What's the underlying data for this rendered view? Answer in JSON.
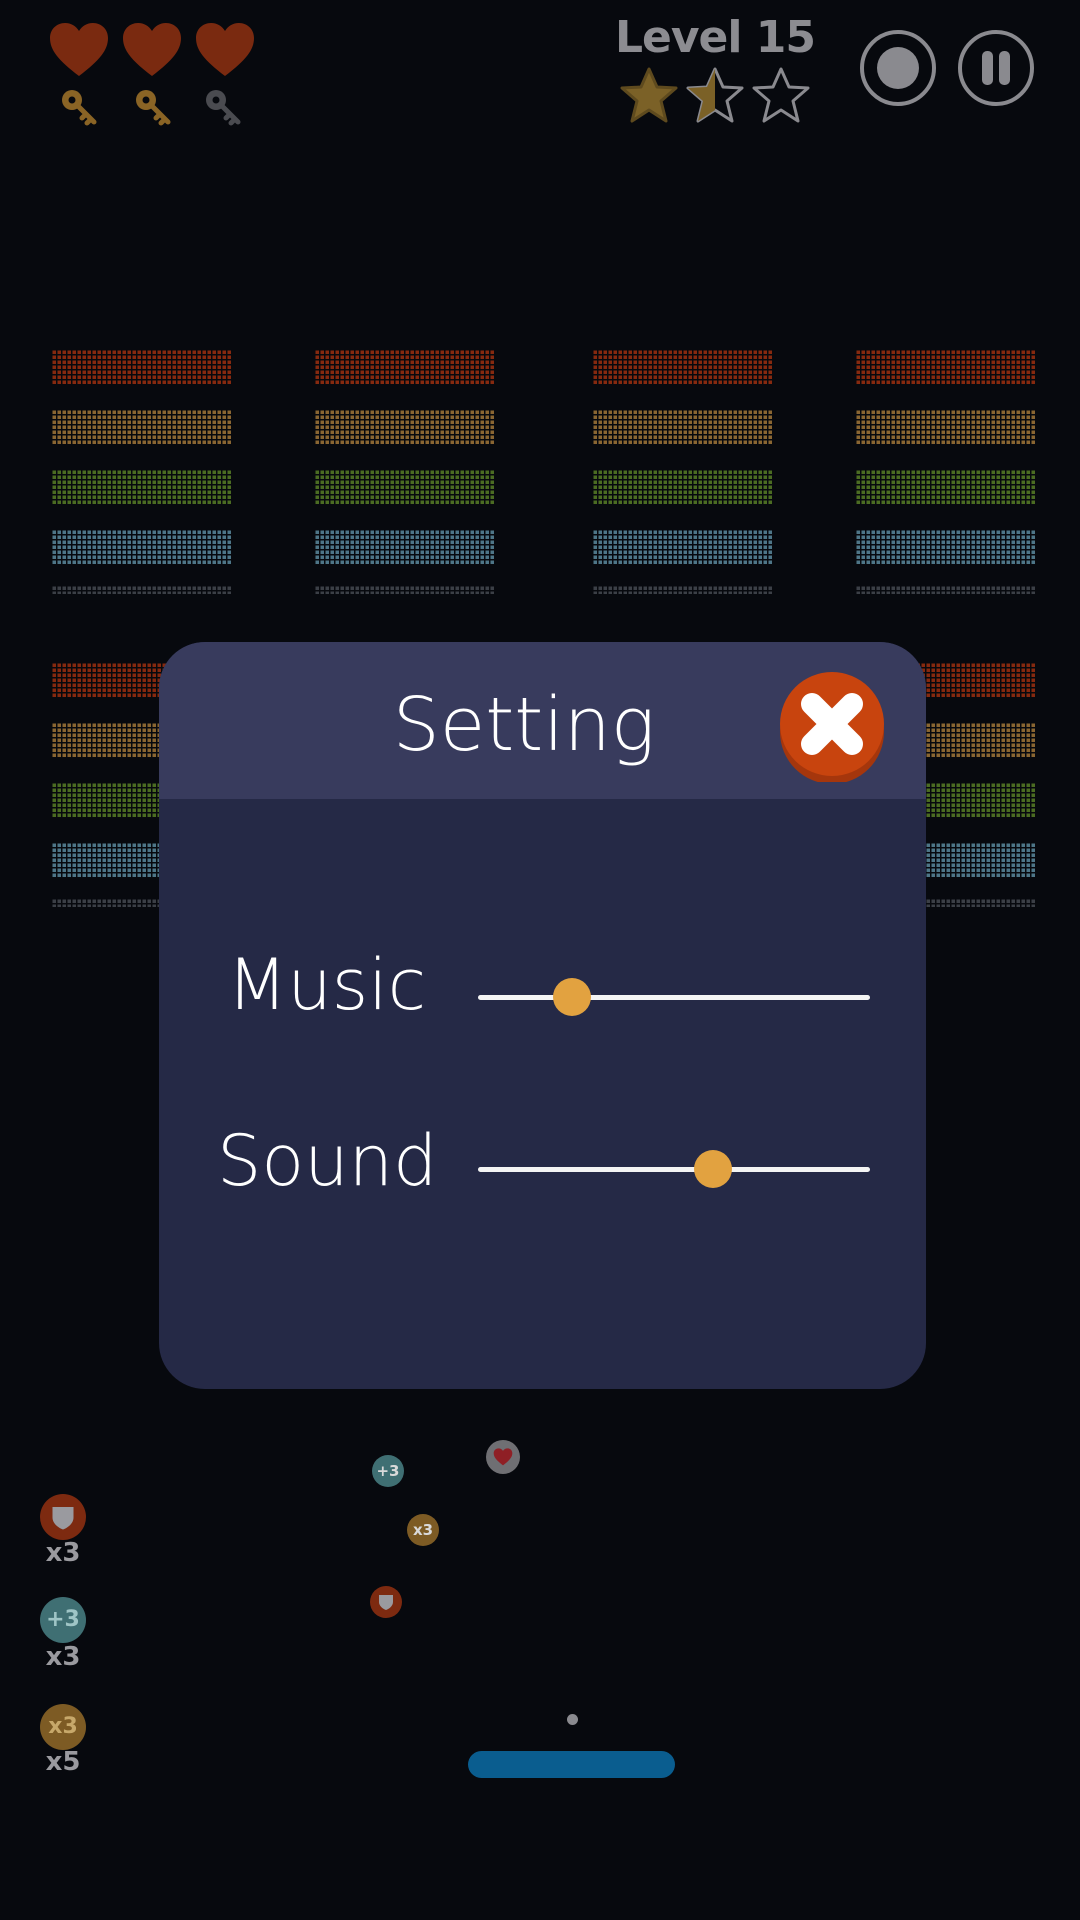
{
  "hud": {
    "level": "Level 15",
    "lives": [
      {
        "icon": "heart-icon",
        "color": "#7a2a10"
      },
      {
        "icon": "heart-icon",
        "color": "#7a2a10"
      },
      {
        "icon": "heart-icon",
        "color": "#7a2a10"
      }
    ],
    "keys": [
      {
        "icon": "key-icon",
        "collected": true
      },
      {
        "icon": "key-icon",
        "collected": true
      },
      {
        "icon": "key-icon",
        "collected": false
      }
    ],
    "stars_earned": 1.5,
    "stars_total": 3
  },
  "brick_colors": [
    "#86290f",
    "#8a6632",
    "#4b6c22",
    "#4e7688",
    "#3b3f46"
  ],
  "settings": {
    "title": "Setting",
    "music_label": "Music",
    "sound_label": "Sound",
    "music_level": 0.24,
    "sound_level": 0.6
  },
  "field_powerups": [
    {
      "icon": "plus-three-icon",
      "label": "+3"
    },
    {
      "icon": "heart-icon",
      "label": ""
    },
    {
      "icon": "multiplier-icon",
      "label": "x3"
    },
    {
      "icon": "shield-icon",
      "label": ""
    }
  ],
  "inventory": [
    {
      "icon": "shield-icon",
      "label": "",
      "count": "x3"
    },
    {
      "icon": "plus-three-icon",
      "label": "+3",
      "count": "x3"
    },
    {
      "icon": "multiplier-icon",
      "label": "x3",
      "count": "x5"
    }
  ],
  "colors": {
    "accent": "#e2a240",
    "close": "#c8440e",
    "paddle": "#0a5d8f",
    "panel": "#252946",
    "panel_header": "#383b5d"
  }
}
